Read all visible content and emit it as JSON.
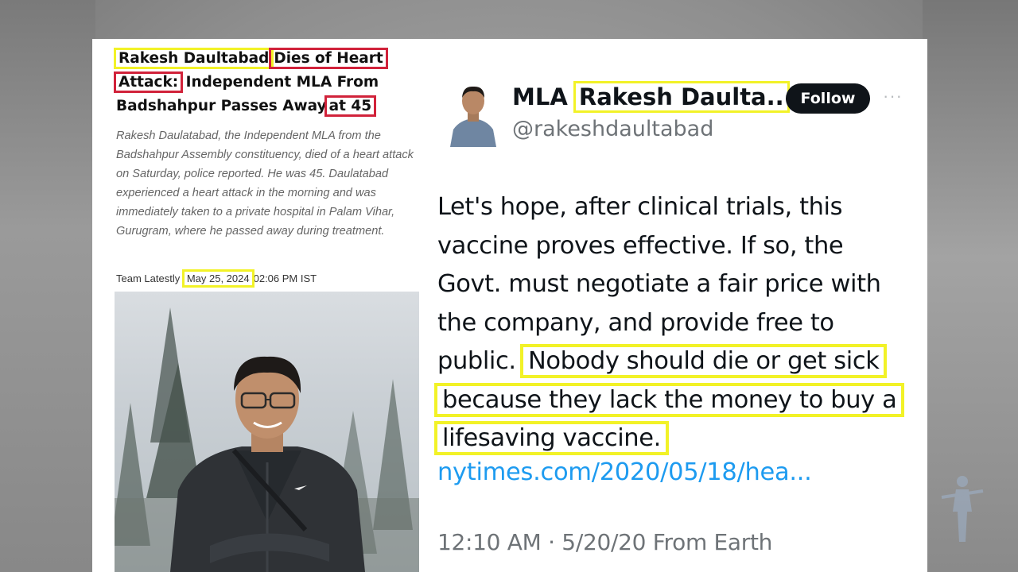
{
  "article": {
    "headline": {
      "part1": "Rakesh Daultabad",
      "part2": "Dies of Heart",
      "part3": "Attack:",
      "part4": " Independent MLA From",
      "part5": "Badshahpur Passes Away",
      "part6": "at 45"
    },
    "summary": "Rakesh Daulatabad, the Independent MLA from the Badshahpur Assembly constituency, died of a heart attack on Saturday, police reported. He was 45. Daulatabad experienced a heart attack in the morning and was immediately taken to a private hospital in Palam Vihar, Gurugram, where he passed away during treatment.",
    "byline_author": "Team Latestly",
    "byline_date": "May 25, 2024",
    "byline_time": "02:06 PM IST"
  },
  "tweet": {
    "name_prefix": "MLA",
    "name_highlight": "Rakesh Daulta..",
    "handle": "@rakeshdaultabad",
    "follow_label": "Follow",
    "more_label": "···",
    "body": {
      "line1": "Let's hope, after clinical trials, this",
      "line2": "vaccine proves effective. If so, the",
      "line3": "Govt. must negotiate a fair price with",
      "line4": "the company, and provide free to",
      "line5a": "public.",
      "line5b": "Nobody should die or get sick",
      "line6": "because they lack the money to buy a",
      "line7": "lifesaving vaccine."
    },
    "link": "nytimes.com/2020/05/18/hea...",
    "timestamp": "12:10 AM · 5/20/20 From Earth"
  },
  "colors": {
    "highlight_yellow": "#f2f227",
    "highlight_red": "#d1223a",
    "link_blue": "#1d9bf0",
    "follow_bg": "#0f1419"
  },
  "icons": [
    "more-options-icon",
    "watermark-soldier-icon"
  ]
}
